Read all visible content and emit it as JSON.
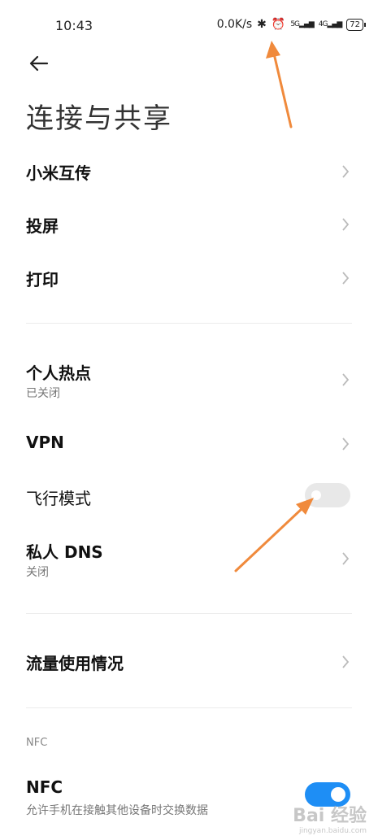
{
  "status_bar": {
    "time": "10:43",
    "speed": "0.0K/s",
    "sig1": "5G",
    "sig2": "4G",
    "battery": "72"
  },
  "header": {
    "title": "连接与共享"
  },
  "items": {
    "xiaomi_share": "小米互传",
    "cast": "投屏",
    "print": "打印",
    "hotspot": "个人热点",
    "hotspot_sub": "已关闭",
    "vpn": "VPN",
    "airplane": "飞行模式",
    "private_dns": "私人 DNS",
    "private_dns_sub": "关闭",
    "data_usage": "流量使用情况",
    "nfc_section": "NFC",
    "nfc": "NFC",
    "nfc_sub": "允许手机在接触其他设备时交换数据"
  },
  "toggles": {
    "airplane_on": false,
    "nfc_on": true
  },
  "watermark": {
    "main": "Bai 经验",
    "sub": "jingyan.baidu.com"
  },
  "colors": {
    "accent": "#1e8ef5",
    "annotation_arrow": "#f08a3c"
  }
}
